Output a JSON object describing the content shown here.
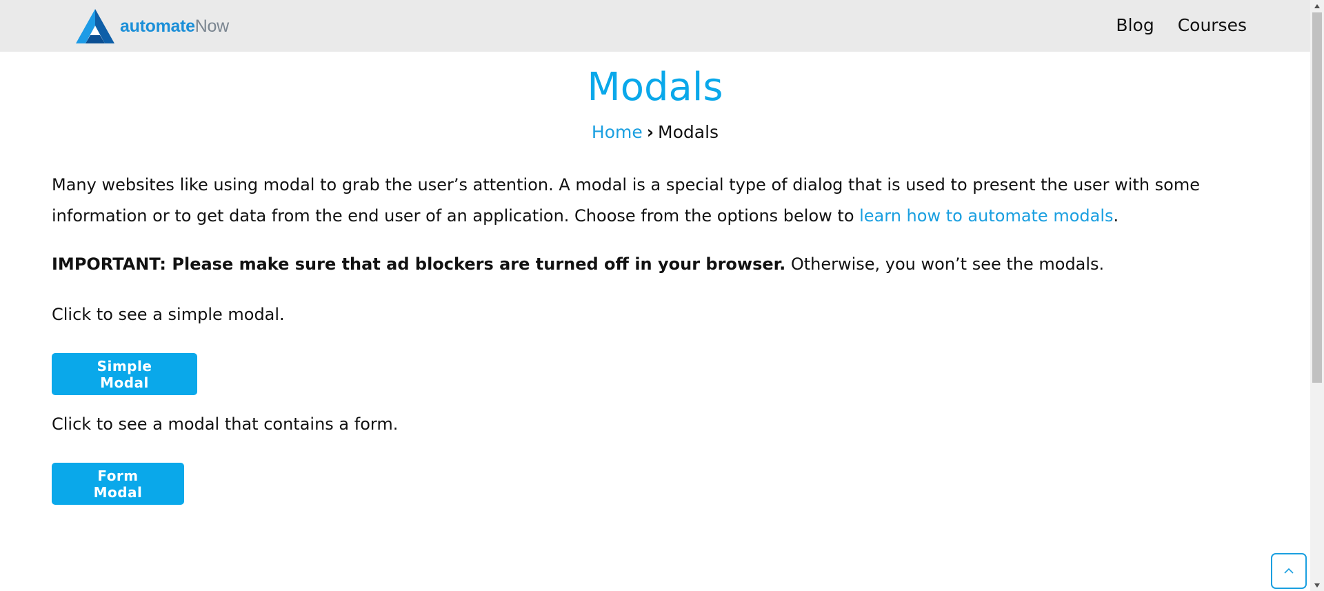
{
  "header": {
    "logo": {
      "text_primary": "automate",
      "text_secondary": "Now"
    },
    "nav": [
      {
        "label": "Blog"
      },
      {
        "label": "Courses"
      }
    ]
  },
  "title": "Modals",
  "breadcrumb": {
    "home": "Home",
    "separator": "›",
    "current": "Modals"
  },
  "content": {
    "intro_text": "Many websites like using modal to grab the user’s attention. A modal is a special type of dialog that is used to present the user with some information or to get data from the end user of an application. Choose from the options below to ",
    "intro_link": "learn how to automate modals",
    "intro_end": ".",
    "important_bold": "IMPORTANT: Please make sure that ad blockers are turned off in your browser.",
    "important_rest": " Otherwise, you won’t see the modals.",
    "simple_text": "Click to see a simple modal.",
    "simple_button": "Simple Modal",
    "form_text": "Click to see a modal that contains a form.",
    "form_button": "Form Modal"
  },
  "icons": {
    "scroll_top": "chevron-up-icon",
    "logo": "automatenow-logo-icon"
  },
  "colors": {
    "accent": "#0aa8ea",
    "link": "#1a9fe0",
    "header_bg": "#eaeaea",
    "logo_primary": "#1b8fd8",
    "logo_secondary": "#7a8590"
  }
}
